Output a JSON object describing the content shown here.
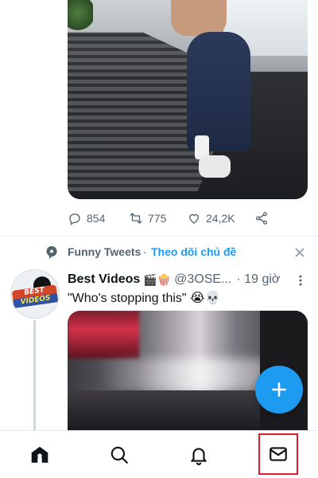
{
  "tweet1": {
    "stats": {
      "replies": "854",
      "retweets": "775",
      "likes": "24,2K"
    }
  },
  "topic": {
    "name": "Funny Tweets",
    "separator": "·",
    "follow_label": "Theo dõi chủ đề"
  },
  "tweet2": {
    "avatar_logo_line1": "BEST",
    "avatar_logo_line2": "VIDEOS",
    "display_name": "Best Videos",
    "emojis": "🎬🍿",
    "handle": "@3OSE...",
    "time": "· 19 giờ",
    "text": "\"Who's stopping this\" 😭💀"
  },
  "colors": {
    "accent": "#1d9bf0",
    "text_secondary": "#536471",
    "highlight_box": "#e01b2a"
  },
  "nav": {
    "items": [
      "home-icon",
      "search-icon",
      "bell-icon",
      "mail-icon"
    ]
  }
}
